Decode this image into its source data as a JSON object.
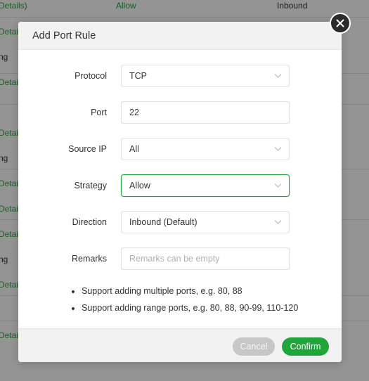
{
  "background_table": {
    "header": {
      "col1": "Details)",
      "col2": "Allow",
      "col3": "Inbound"
    },
    "cells": [
      "Detail",
      "ng",
      "Detail",
      "Detail",
      "ng",
      "Detail",
      "Detail",
      "Detail",
      "ng",
      "Detail",
      "Detail"
    ]
  },
  "dialog": {
    "title": "Add Port Rule",
    "close_icon": "close-icon",
    "fields": {
      "protocol": {
        "label": "Protocol",
        "value": "TCP"
      },
      "port": {
        "label": "Port",
        "value": "22"
      },
      "source_ip": {
        "label": "Source IP",
        "value": "All"
      },
      "strategy": {
        "label": "Strategy",
        "value": "Allow"
      },
      "direction": {
        "label": "Direction",
        "value": "Inbound (Default)"
      },
      "remarks": {
        "label": "Remarks",
        "value": "",
        "placeholder": "Remarks can be empty"
      }
    },
    "notes": [
      "Support adding multiple ports, e.g. 80, 88",
      "Support adding range ports, e.g. 80, 88, 90-99, 110-120"
    ],
    "footer": {
      "cancel_label": "Cancel",
      "confirm_label": "Confirm"
    }
  },
  "colors": {
    "accent": "#20a53a",
    "overlay": "rgba(0,0,0,0.42)",
    "header_bg": "#f2f2f2"
  }
}
